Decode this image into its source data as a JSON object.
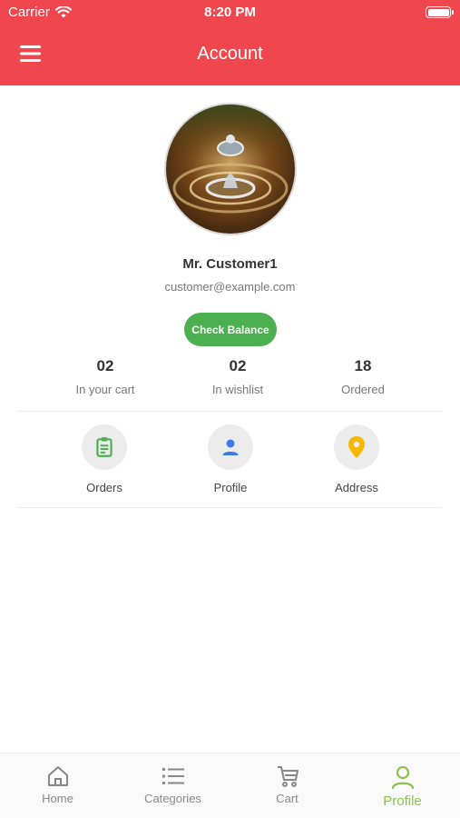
{
  "status_bar": {
    "carrier": "Carrier",
    "time": "8:20 PM"
  },
  "header": {
    "title": "Account"
  },
  "profile": {
    "name": "Mr. Customer1",
    "email": "customer@example.com",
    "check_balance_label": "Check Balance"
  },
  "stats": [
    {
      "value": "02",
      "label": "In your cart"
    },
    {
      "value": "02",
      "label": "In wishlist"
    },
    {
      "value": "18",
      "label": "Ordered"
    }
  ],
  "actions": [
    {
      "label": "Orders",
      "icon": "clipboard-icon",
      "color": "#4caf50"
    },
    {
      "label": "Profile",
      "icon": "user-icon",
      "color": "#3d7ae8"
    },
    {
      "label": "Address",
      "icon": "location-pin-icon",
      "color": "#f5b800"
    }
  ],
  "tabbar": {
    "items": [
      {
        "label": "Home",
        "icon": "home-icon",
        "active": false
      },
      {
        "label": "Categories",
        "icon": "list-icon",
        "active": false
      },
      {
        "label": "Cart",
        "icon": "cart-icon",
        "active": false
      },
      {
        "label": "Profile",
        "icon": "person-icon",
        "active": true
      }
    ]
  },
  "colors": {
    "header": "#f0474f",
    "button": "#4caf50",
    "active_tab": "#8bc34a"
  }
}
